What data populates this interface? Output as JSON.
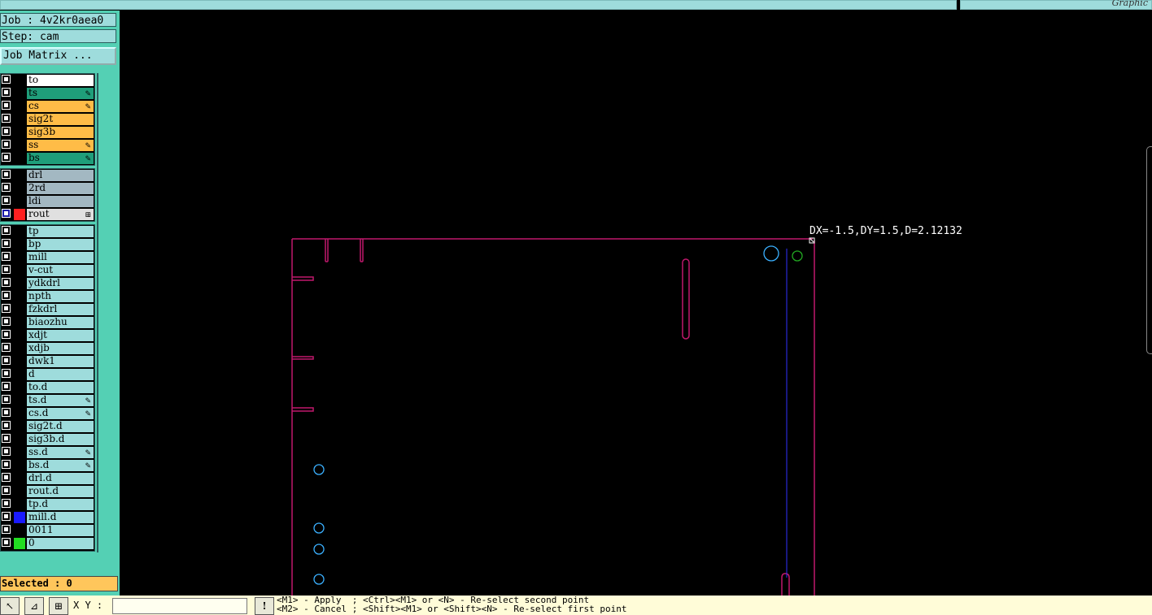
{
  "window": {
    "corner_label": "Graphic"
  },
  "panel": {
    "job_label": "Job : 4v2kr0aea0",
    "step_label": "Step: cam",
    "job_matrix_button": "Job Matrix ...",
    "selected_label": "Selected : 0",
    "groups": [
      [
        {
          "name": "to",
          "color": "#ffffff",
          "mark": "",
          "swatch": ""
        },
        {
          "name": "ts",
          "color": "#1f9e7a",
          "mark": "✎",
          "swatch": ""
        },
        {
          "name": "cs",
          "color": "#ffbc47",
          "mark": "✎",
          "swatch": ""
        },
        {
          "name": "sig2t",
          "color": "#ffbc47",
          "mark": "",
          "swatch": ""
        },
        {
          "name": "sig3b",
          "color": "#ffbc47",
          "mark": "",
          "swatch": ""
        },
        {
          "name": "ss",
          "color": "#ffbc47",
          "mark": "✎",
          "swatch": ""
        },
        {
          "name": "bs",
          "color": "#1f9e7a",
          "mark": "✎",
          "swatch": ""
        }
      ],
      [
        {
          "name": "drl",
          "color": "#a3b8c2",
          "mark": "",
          "swatch": ""
        },
        {
          "name": "2rd",
          "color": "#a3b8c2",
          "mark": "",
          "swatch": ""
        },
        {
          "name": "ldi",
          "color": "#a3b8c2",
          "mark": "",
          "swatch": ""
        },
        {
          "name": "rout",
          "color": "#e0e0e0",
          "mark": "⊞",
          "swatch": "#ff2020",
          "active": true
        }
      ],
      [
        {
          "name": "tp",
          "color": "#9edcdc",
          "mark": "",
          "swatch": ""
        },
        {
          "name": "bp",
          "color": "#9edcdc",
          "mark": "",
          "swatch": ""
        },
        {
          "name": "mill",
          "color": "#9edcdc",
          "mark": "",
          "swatch": ""
        },
        {
          "name": "v-cut",
          "color": "#9edcdc",
          "mark": "",
          "swatch": ""
        },
        {
          "name": "ydkdrl",
          "color": "#9edcdc",
          "mark": "",
          "swatch": ""
        },
        {
          "name": "npth",
          "color": "#9edcdc",
          "mark": "",
          "swatch": ""
        },
        {
          "name": "fzkdrl",
          "color": "#9edcdc",
          "mark": "",
          "swatch": ""
        },
        {
          "name": "biaozhu",
          "color": "#9edcdc",
          "mark": "",
          "swatch": ""
        },
        {
          "name": "xdjt",
          "color": "#9edcdc",
          "mark": "",
          "swatch": ""
        },
        {
          "name": "xdjb",
          "color": "#9edcdc",
          "mark": "",
          "swatch": ""
        },
        {
          "name": "dwk1",
          "color": "#9edcdc",
          "mark": "",
          "swatch": ""
        },
        {
          "name": "d",
          "color": "#9edcdc",
          "mark": "",
          "swatch": ""
        },
        {
          "name": "to.d",
          "color": "#9edcdc",
          "mark": "",
          "swatch": ""
        },
        {
          "name": "ts.d",
          "color": "#9edcdc",
          "mark": "✎",
          "swatch": ""
        },
        {
          "name": "cs.d",
          "color": "#9edcdc",
          "mark": "✎",
          "swatch": ""
        },
        {
          "name": "sig2t.d",
          "color": "#9edcdc",
          "mark": "",
          "swatch": ""
        },
        {
          "name": "sig3b.d",
          "color": "#9edcdc",
          "mark": "",
          "swatch": ""
        },
        {
          "name": "ss.d",
          "color": "#9edcdc",
          "mark": "✎",
          "swatch": ""
        },
        {
          "name": "bs.d",
          "color": "#9edcdc",
          "mark": "✎",
          "swatch": ""
        },
        {
          "name": "drl.d",
          "color": "#9edcdc",
          "mark": "",
          "swatch": ""
        },
        {
          "name": "rout.d",
          "color": "#9edcdc",
          "mark": "",
          "swatch": ""
        },
        {
          "name": "tp.d",
          "color": "#9edcdc",
          "mark": "",
          "swatch": ""
        },
        {
          "name": "mill.d",
          "color": "#9edcdc",
          "mark": "",
          "swatch": "#1a1aff"
        },
        {
          "name": "0011",
          "color": "#9edcdc",
          "mark": "",
          "swatch": ""
        },
        {
          "name": "0",
          "color": "#9edcdc",
          "mark": "",
          "swatch": "#22dd22"
        }
      ]
    ]
  },
  "canvas": {
    "measure_readout": "DX=-1.5,DY=1.5,D=2.12132",
    "colors": {
      "outline": "#c0186c",
      "guide": "#3030ff",
      "drill": "#3ab0ff",
      "pad": "#22aa22"
    }
  },
  "statusbar": {
    "xy_label": "X Y :",
    "xy_value": "",
    "hint_line1": "<M1> - Apply  ; <Ctrl><M1> or <N> - Re-select second point",
    "hint_line2": "<M2> - Cancel ; <Shift><M1> or <Shift><N> - Re-select first point"
  }
}
